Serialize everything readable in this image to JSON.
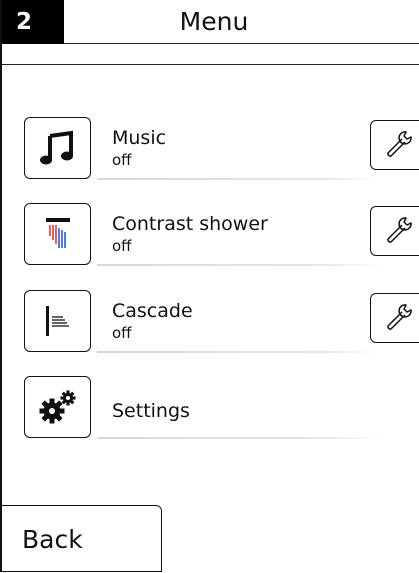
{
  "header": {
    "page_number": "2",
    "title": "Menu"
  },
  "menu": {
    "items": [
      {
        "label": "Music",
        "status": "off",
        "icon": "music-note-icon",
        "has_settings": true
      },
      {
        "label": "Contrast shower",
        "status": "off",
        "icon": "contrast-shower-icon",
        "has_settings": true
      },
      {
        "label": "Cascade",
        "status": "off",
        "icon": "cascade-icon",
        "has_settings": true
      },
      {
        "label": "Settings",
        "status": "",
        "icon": "gears-icon",
        "has_settings": false
      }
    ]
  },
  "footer": {
    "back_label": "Back"
  },
  "colors": {
    "header_badge_bg": "#000000",
    "text": "#111111",
    "shower_warm": "#d32f2f",
    "shower_cold": "#1e4fc8"
  }
}
